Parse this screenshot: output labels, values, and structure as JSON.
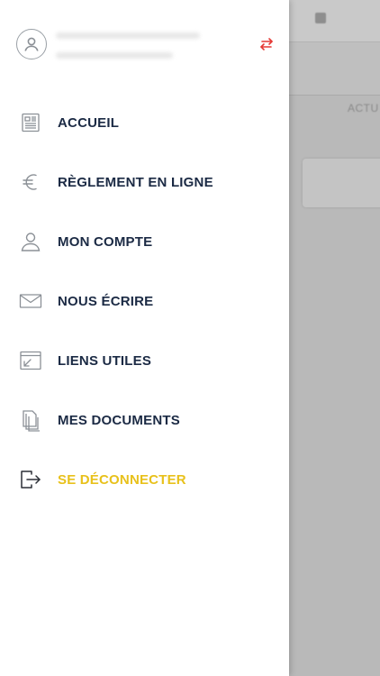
{
  "background": {
    "tab_text": "ACTU"
  },
  "header": {
    "avatar_icon": "user-circle-icon",
    "switch_icon": "swap-arrows-icon",
    "switch_color": "#e53935"
  },
  "menu": {
    "items": [
      {
        "label": "ACCUEIL",
        "icon": "newspaper-icon"
      },
      {
        "label": "RÈGLEMENT EN LIGNE",
        "icon": "euro-icon"
      },
      {
        "label": "MON COMPTE",
        "icon": "user-icon"
      },
      {
        "label": "NOUS ÉCRIRE",
        "icon": "envelope-icon"
      },
      {
        "label": "LIENS UTILES",
        "icon": "external-link-icon"
      },
      {
        "label": "MES DOCUMENTS",
        "icon": "documents-icon"
      },
      {
        "label": "SE DÉCONNECTER",
        "icon": "logout-icon"
      }
    ]
  },
  "colors": {
    "label": "#1b2a44",
    "logout": "#e8c11b",
    "icon": "#8b9096",
    "overlay": "#b9b9b9"
  }
}
